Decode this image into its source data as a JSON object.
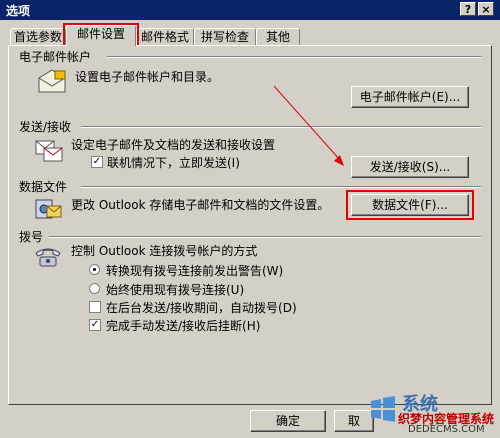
{
  "window": {
    "title": "选项",
    "help_label": "?",
    "close_label": "×"
  },
  "tabs": [
    {
      "label": "首选参数"
    },
    {
      "label": "邮件设置"
    },
    {
      "label": "邮件格式"
    },
    {
      "label": "拼写检查"
    },
    {
      "label": "其他"
    }
  ],
  "email_accounts": {
    "title": "电子邮件帐户",
    "description": "设置电子邮件帐户和目录。",
    "button": "电子邮件帐户(E)..."
  },
  "send_receive": {
    "title": "发送/接收",
    "description": "设定电子邮件及文档的发送和接收设置",
    "checkbox": {
      "label": "联机情况下，立即发送(I)",
      "checked": true
    },
    "button": "发送/接收(S)..."
  },
  "data_files": {
    "title": "数据文件",
    "description": "更改 Outlook 存储电子邮件和文档的文件设置。",
    "button": "数据文件(F)..."
  },
  "dialup": {
    "title": "拨号",
    "description": "控制 Outlook 连接拨号帐户的方式",
    "radios": [
      {
        "label": "转换现有拨号连接前发出警告(W)",
        "selected": true
      },
      {
        "label": "始终使用现有拨号连接(U)",
        "selected": false
      }
    ],
    "checkboxes": [
      {
        "label": "在后台发送/接收期间，自动拨号(D)",
        "checked": false
      },
      {
        "label": "完成手动发送/接收后挂断(H)",
        "checked": true
      }
    ]
  },
  "footer": {
    "ok_label": "确定",
    "cancel_label": "取"
  },
  "watermark": {
    "brand": "系统",
    "site_text": "织梦内容管理系统",
    "url": "DEDECMS.COM"
  },
  "colors": {
    "titlebar": "#0a246a",
    "dialog": "#d4d0c8",
    "highlight": "#e30000"
  }
}
